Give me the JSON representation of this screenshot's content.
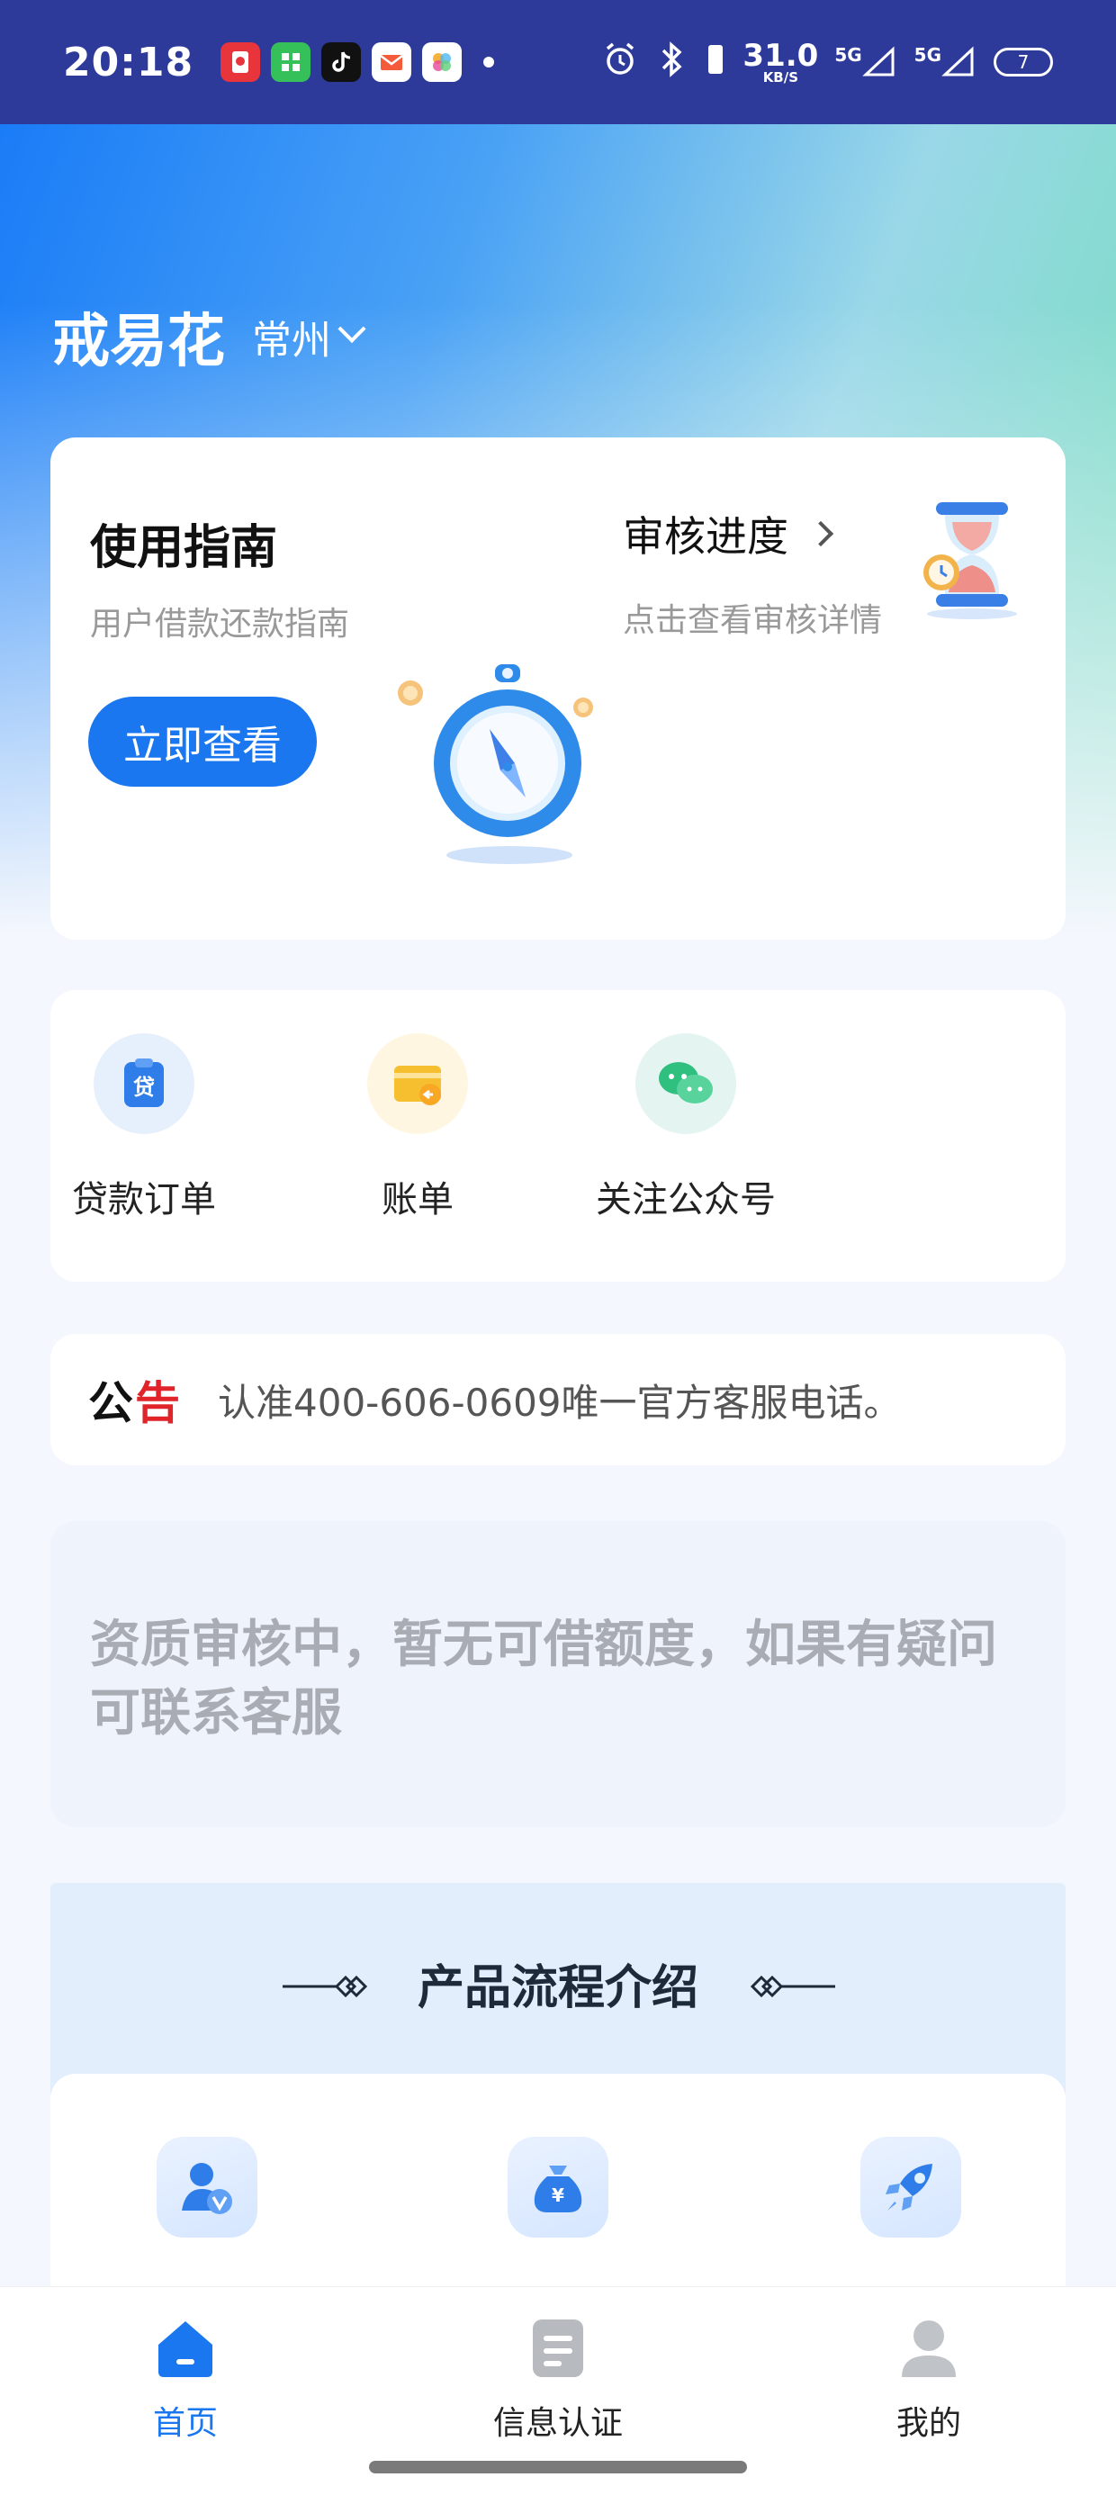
{
  "status_bar": {
    "time": "20:18",
    "net_speed": "31.0",
    "net_unit": "KB/S",
    "signal_1": "5G",
    "signal_2": "5G",
    "battery": "7",
    "apps": [
      {
        "icon": "red-envelope-app-icon",
        "color": "#e8343b"
      },
      {
        "icon": "grid-app-icon",
        "color": "#36c05a"
      },
      {
        "icon": "tiktok-app-icon",
        "color": "#111111"
      },
      {
        "icon": "mail-app-icon",
        "color": "#f35b3a"
      },
      {
        "icon": "photos-app-icon",
        "color": "#ffffff"
      }
    ]
  },
  "header": {
    "brand": "戒易花",
    "city": "常州"
  },
  "guide_card": {
    "title": "使用指南",
    "subtitle": "用户借款还款指南",
    "button": "立即查看",
    "review_title": "审核进度",
    "review_subtitle": "点击查看审核详情"
  },
  "shortcuts": [
    {
      "label": "贷款订单",
      "icon": "loan-order-icon",
      "bg": "#e6f0fd"
    },
    {
      "label": "账单",
      "icon": "bill-icon",
      "bg": "#fff6e1"
    },
    {
      "label": "关注公众号",
      "icon": "wechat-icon",
      "bg": "#e3f4f1"
    }
  ],
  "notice": {
    "tag_a": "公",
    "tag_b": "告",
    "text": "认准400-606-0609唯一官方客服电话。"
  },
  "quota_message": "资质审核中，暂无可借额度，如果有疑问可联系客服",
  "product_flow": {
    "title": "产品流程介绍"
  },
  "bottom_nav": [
    {
      "label": "首页",
      "icon": "home-icon",
      "active": true
    },
    {
      "label": "信息认证",
      "icon": "document-icon",
      "active": false
    },
    {
      "label": "我的",
      "icon": "profile-icon",
      "active": false
    }
  ],
  "colors": {
    "accent": "#1a77f0",
    "status_bar": "#2d3a9a",
    "notice_red": "#e0242a"
  }
}
